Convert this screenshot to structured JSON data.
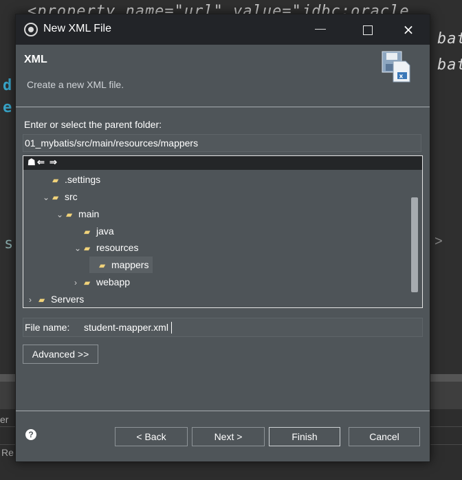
{
  "background": {
    "code_line_1": "<property name=\"url\" value=\"jdbc:oracle",
    "code_line_2": "bat",
    "code_line_3": "bat",
    "gutter_d": "d",
    "gutter_e": "e",
    "gutter_s": "s",
    "bottom_label_1": "er",
    "bottom_label_2": "Re"
  },
  "dialog": {
    "title": "New XML File",
    "icon": "eclipse-app-icon",
    "controls": {
      "minimize": "minimize-icon",
      "maximize": "maximize-icon",
      "close": "×"
    }
  },
  "banner": {
    "title": "XML",
    "description": "Create a new XML file.",
    "icon": "xml-file-wizard-icon"
  },
  "parent_folder": {
    "label": "Enter or select the parent folder:",
    "value": "01_mybatis/src/main/resources/mappers"
  },
  "tree": {
    "toolbar": {
      "home": "☗",
      "back": "⇐",
      "forward": "⇒"
    },
    "items": [
      {
        "label": ".settings",
        "chevron": "",
        "depth": 1
      },
      {
        "label": "src",
        "chevron": "⌄",
        "depth": 1
      },
      {
        "label": "main",
        "chevron": "⌄",
        "depth": 2
      },
      {
        "label": "java",
        "chevron": "",
        "depth": 3
      },
      {
        "label": "resources",
        "chevron": "⌄",
        "depth": 3
      },
      {
        "label": "mappers",
        "chevron": "",
        "depth": 4,
        "selected": true
      },
      {
        "label": "webapp",
        "chevron": "›",
        "depth": 3
      },
      {
        "label": "Servers",
        "chevron": "›",
        "depth": 0
      }
    ]
  },
  "file_name": {
    "label": "File name:",
    "value": "student-mapper.xml"
  },
  "buttons": {
    "advanced": "Advanced >>",
    "back": "< Back",
    "next": "Next >",
    "finish": "Finish",
    "cancel": "Cancel",
    "help": "?"
  },
  "colors": {
    "dialog_bg": "#4f5559",
    "titlebar_bg": "#222428",
    "folder_icon": "#f0d27a",
    "text": "#ffffff"
  }
}
